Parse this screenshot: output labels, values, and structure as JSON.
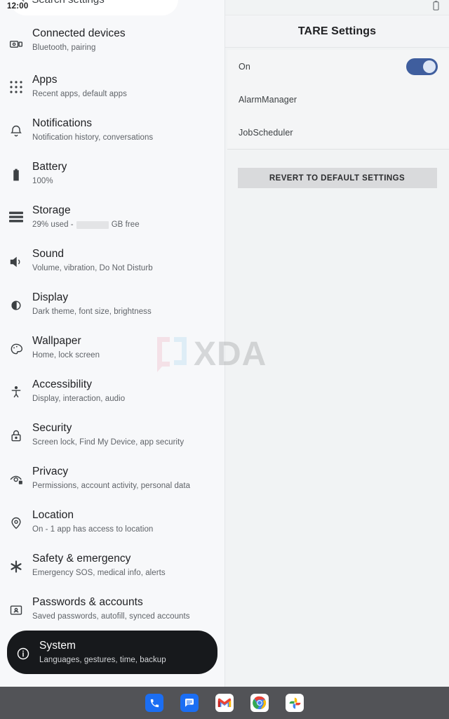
{
  "status": {
    "time": "12:00",
    "battery_icon": "battery-icon"
  },
  "left": {
    "search": {
      "back_icon": "back-arrow-icon",
      "placeholder": "Search settings",
      "value": "Search settings"
    },
    "items": [
      {
        "icon": "connected-devices-icon",
        "title": "Connected devices",
        "sub": "Bluetooth, pairing",
        "selected": false
      },
      {
        "icon": "apps-grid-icon",
        "title": "Apps",
        "sub": "Recent apps, default apps",
        "selected": false
      },
      {
        "icon": "bell-icon",
        "title": "Notifications",
        "sub": "Notification history, conversations",
        "selected": false
      },
      {
        "icon": "battery-icon",
        "title": "Battery",
        "sub": "100%",
        "selected": false
      },
      {
        "icon": "storage-icon",
        "title": "Storage",
        "sub_before": "29% used - ",
        "sub_after": " GB free",
        "redacted": true,
        "selected": false
      },
      {
        "icon": "sound-icon",
        "title": "Sound",
        "sub": "Volume, vibration, Do Not Disturb",
        "selected": false
      },
      {
        "icon": "display-icon",
        "title": "Display",
        "sub": "Dark theme, font size, brightness",
        "selected": false
      },
      {
        "icon": "wallpaper-icon",
        "title": "Wallpaper",
        "sub": "Home, lock screen",
        "selected": false
      },
      {
        "icon": "accessibility-icon",
        "title": "Accessibility",
        "sub": "Display, interaction, audio",
        "selected": false
      },
      {
        "icon": "lock-icon",
        "title": "Security",
        "sub": "Screen lock, Find My Device, app security",
        "selected": false
      },
      {
        "icon": "privacy-eye-icon",
        "title": "Privacy",
        "sub": "Permissions, account activity, personal data",
        "selected": false
      },
      {
        "icon": "location-pin-icon",
        "title": "Location",
        "sub": "On - 1 app has access to location",
        "selected": false
      },
      {
        "icon": "asterisk-icon",
        "title": "Safety & emergency",
        "sub": "Emergency SOS, medical info, alerts",
        "selected": false
      },
      {
        "icon": "passwords-icon",
        "title": "Passwords & accounts",
        "sub": "Saved passwords, autofill, synced accounts",
        "selected": false
      },
      {
        "icon": "info-circle-icon",
        "title": "System",
        "sub": "Languages, gestures, time, backup",
        "selected": true
      }
    ]
  },
  "right": {
    "title": "TARE Settings",
    "preferences": [
      {
        "label": "On",
        "type": "toggle",
        "value": true
      },
      {
        "label": "AlarmManager",
        "type": "link"
      },
      {
        "label": "JobScheduler",
        "type": "link"
      }
    ],
    "revert_button": "REVERT TO DEFAULT SETTINGS"
  },
  "watermark": {
    "text": "XDA",
    "logo_icon": "xda-bracket-logo-icon"
  },
  "taskbar": {
    "apps": [
      {
        "name": "phone-app-icon",
        "label": "Phone"
      },
      {
        "name": "messages-app-icon",
        "label": "Messages"
      },
      {
        "name": "gmail-app-icon",
        "label": "Gmail"
      },
      {
        "name": "chrome-app-icon",
        "label": "Chrome"
      },
      {
        "name": "photos-app-icon",
        "label": "Photos"
      }
    ]
  },
  "colors": {
    "accent_toggle": "#3f5e9e",
    "selected_pill": "#17191c",
    "taskbar_bg": "#525357",
    "panel_bg": "#f1f3f4"
  }
}
